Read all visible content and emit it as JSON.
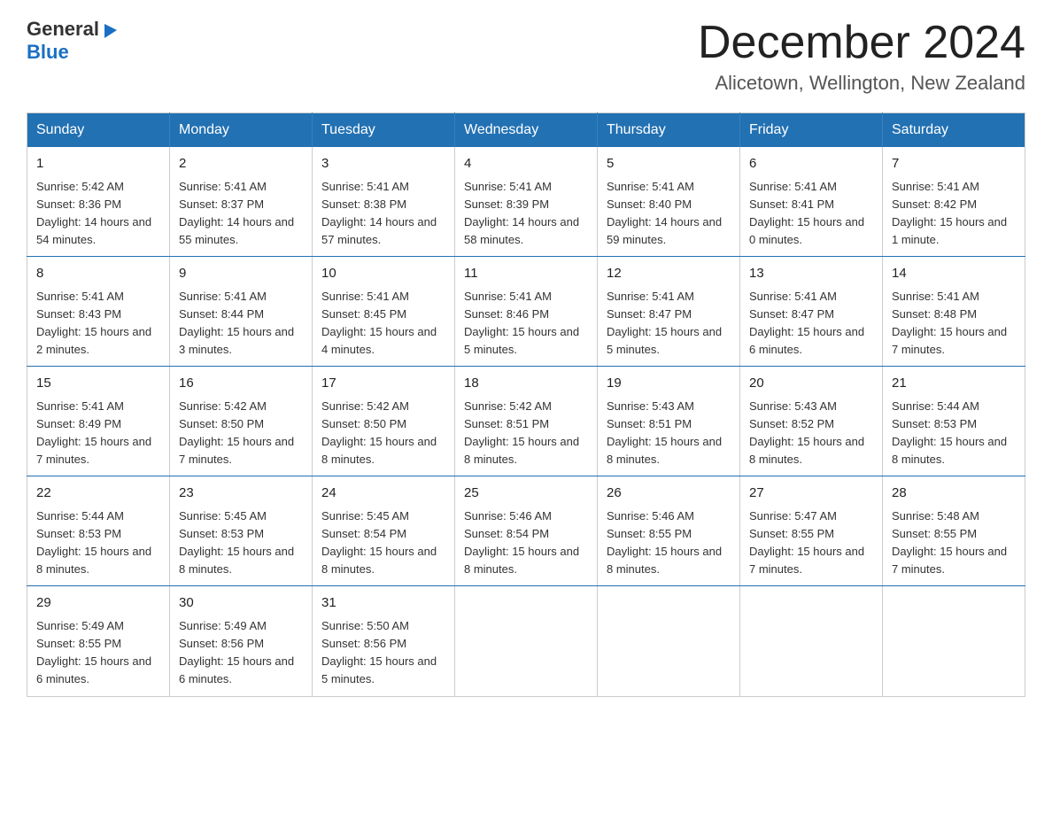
{
  "header": {
    "logo_general": "General",
    "logo_blue": "Blue",
    "month_title": "December 2024",
    "location": "Alicetown, Wellington, New Zealand"
  },
  "days_of_week": [
    "Sunday",
    "Monday",
    "Tuesday",
    "Wednesday",
    "Thursday",
    "Friday",
    "Saturday"
  ],
  "weeks": [
    [
      {
        "day": "1",
        "sunrise": "5:42 AM",
        "sunset": "8:36 PM",
        "daylight": "14 hours and 54 minutes."
      },
      {
        "day": "2",
        "sunrise": "5:41 AM",
        "sunset": "8:37 PM",
        "daylight": "14 hours and 55 minutes."
      },
      {
        "day": "3",
        "sunrise": "5:41 AM",
        "sunset": "8:38 PM",
        "daylight": "14 hours and 57 minutes."
      },
      {
        "day": "4",
        "sunrise": "5:41 AM",
        "sunset": "8:39 PM",
        "daylight": "14 hours and 58 minutes."
      },
      {
        "day": "5",
        "sunrise": "5:41 AM",
        "sunset": "8:40 PM",
        "daylight": "14 hours and 59 minutes."
      },
      {
        "day": "6",
        "sunrise": "5:41 AM",
        "sunset": "8:41 PM",
        "daylight": "15 hours and 0 minutes."
      },
      {
        "day": "7",
        "sunrise": "5:41 AM",
        "sunset": "8:42 PM",
        "daylight": "15 hours and 1 minute."
      }
    ],
    [
      {
        "day": "8",
        "sunrise": "5:41 AM",
        "sunset": "8:43 PM",
        "daylight": "15 hours and 2 minutes."
      },
      {
        "day": "9",
        "sunrise": "5:41 AM",
        "sunset": "8:44 PM",
        "daylight": "15 hours and 3 minutes."
      },
      {
        "day": "10",
        "sunrise": "5:41 AM",
        "sunset": "8:45 PM",
        "daylight": "15 hours and 4 minutes."
      },
      {
        "day": "11",
        "sunrise": "5:41 AM",
        "sunset": "8:46 PM",
        "daylight": "15 hours and 5 minutes."
      },
      {
        "day": "12",
        "sunrise": "5:41 AM",
        "sunset": "8:47 PM",
        "daylight": "15 hours and 5 minutes."
      },
      {
        "day": "13",
        "sunrise": "5:41 AM",
        "sunset": "8:47 PM",
        "daylight": "15 hours and 6 minutes."
      },
      {
        "day": "14",
        "sunrise": "5:41 AM",
        "sunset": "8:48 PM",
        "daylight": "15 hours and 7 minutes."
      }
    ],
    [
      {
        "day": "15",
        "sunrise": "5:41 AM",
        "sunset": "8:49 PM",
        "daylight": "15 hours and 7 minutes."
      },
      {
        "day": "16",
        "sunrise": "5:42 AM",
        "sunset": "8:50 PM",
        "daylight": "15 hours and 7 minutes."
      },
      {
        "day": "17",
        "sunrise": "5:42 AM",
        "sunset": "8:50 PM",
        "daylight": "15 hours and 8 minutes."
      },
      {
        "day": "18",
        "sunrise": "5:42 AM",
        "sunset": "8:51 PM",
        "daylight": "15 hours and 8 minutes."
      },
      {
        "day": "19",
        "sunrise": "5:43 AM",
        "sunset": "8:51 PM",
        "daylight": "15 hours and 8 minutes."
      },
      {
        "day": "20",
        "sunrise": "5:43 AM",
        "sunset": "8:52 PM",
        "daylight": "15 hours and 8 minutes."
      },
      {
        "day": "21",
        "sunrise": "5:44 AM",
        "sunset": "8:53 PM",
        "daylight": "15 hours and 8 minutes."
      }
    ],
    [
      {
        "day": "22",
        "sunrise": "5:44 AM",
        "sunset": "8:53 PM",
        "daylight": "15 hours and 8 minutes."
      },
      {
        "day": "23",
        "sunrise": "5:45 AM",
        "sunset": "8:53 PM",
        "daylight": "15 hours and 8 minutes."
      },
      {
        "day": "24",
        "sunrise": "5:45 AM",
        "sunset": "8:54 PM",
        "daylight": "15 hours and 8 minutes."
      },
      {
        "day": "25",
        "sunrise": "5:46 AM",
        "sunset": "8:54 PM",
        "daylight": "15 hours and 8 minutes."
      },
      {
        "day": "26",
        "sunrise": "5:46 AM",
        "sunset": "8:55 PM",
        "daylight": "15 hours and 8 minutes."
      },
      {
        "day": "27",
        "sunrise": "5:47 AM",
        "sunset": "8:55 PM",
        "daylight": "15 hours and 7 minutes."
      },
      {
        "day": "28",
        "sunrise": "5:48 AM",
        "sunset": "8:55 PM",
        "daylight": "15 hours and 7 minutes."
      }
    ],
    [
      {
        "day": "29",
        "sunrise": "5:49 AM",
        "sunset": "8:55 PM",
        "daylight": "15 hours and 6 minutes."
      },
      {
        "day": "30",
        "sunrise": "5:49 AM",
        "sunset": "8:56 PM",
        "daylight": "15 hours and 6 minutes."
      },
      {
        "day": "31",
        "sunrise": "5:50 AM",
        "sunset": "8:56 PM",
        "daylight": "15 hours and 5 minutes."
      },
      null,
      null,
      null,
      null
    ]
  ],
  "labels": {
    "sunrise": "Sunrise:",
    "sunset": "Sunset:",
    "daylight": "Daylight:"
  }
}
